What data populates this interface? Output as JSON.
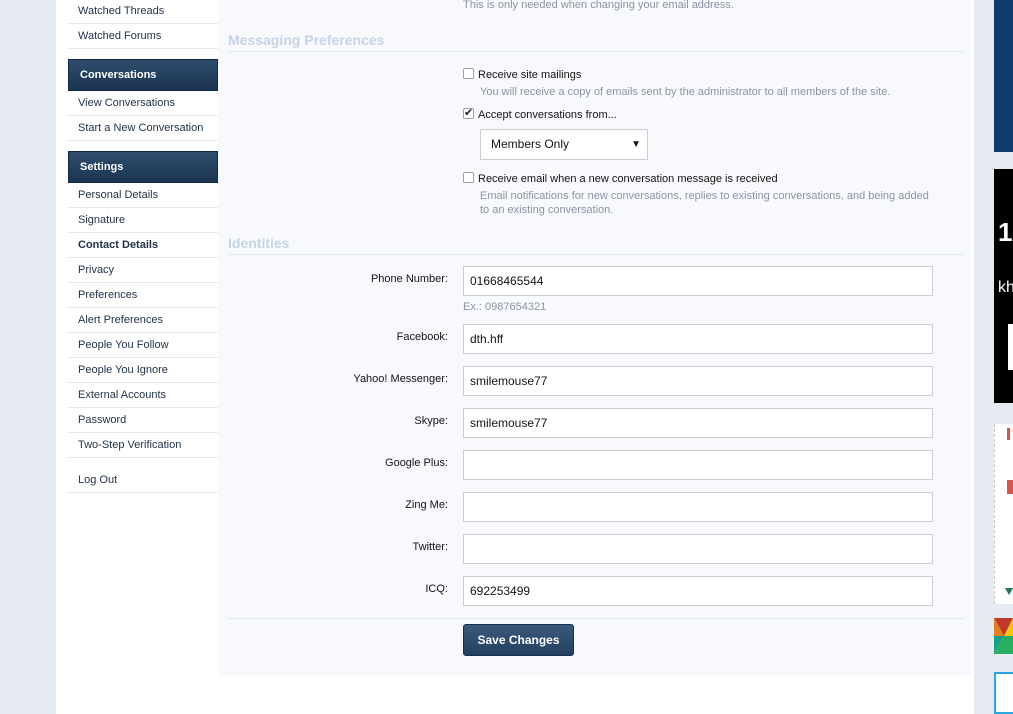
{
  "sidebar": {
    "top_links": [
      "Watched Threads",
      "Watched Forums"
    ],
    "conversations": {
      "heading": "Conversations",
      "links": [
        "View Conversations",
        "Start a New Conversation"
      ]
    },
    "settings": {
      "heading": "Settings",
      "links": [
        "Personal Details",
        "Signature",
        "Contact Details",
        "Privacy",
        "Preferences",
        "Alert Preferences",
        "People You Follow",
        "People You Ignore",
        "External Accounts",
        "Password",
        "Two-Step Verification"
      ],
      "active": "Contact Details"
    },
    "logout": "Log Out"
  },
  "email_hint": "This is only needed when changing your email address.",
  "messaging": {
    "title": "Messaging Preferences",
    "site_mailings": {
      "label": "Receive site mailings",
      "checked": false,
      "desc": "You will receive a copy of emails sent by the administrator to all members of the site."
    },
    "accept_conversations": {
      "label": "Accept conversations from...",
      "checked": true,
      "selected": "Members Only"
    },
    "email_on_message": {
      "label": "Receive email when a new conversation message is received",
      "checked": false,
      "desc": "Email notifications for new conversations, replies to existing conversations, and being added to an existing conversation."
    }
  },
  "identities": {
    "title": "Identities",
    "phone": {
      "label": "Phone Number:",
      "value": "01668465544",
      "hint": "Ex.: 0987654321"
    },
    "facebook": {
      "label": "Facebook:",
      "value": "dth.hff"
    },
    "yahoo": {
      "label": "Yahoo! Messenger:",
      "value": "smilemouse77"
    },
    "skype": {
      "label": "Skype:",
      "value": "smilemouse77"
    },
    "google": {
      "label": "Google Plus:",
      "value": ""
    },
    "zing": {
      "label": "Zing Me:",
      "value": ""
    },
    "twitter": {
      "label": "Twitter:",
      "value": ""
    },
    "icq": {
      "label": "ICQ:",
      "value": "692253499"
    }
  },
  "save_label": "Save Changes",
  "ad_text": {
    "big": "1",
    "small": "kh"
  }
}
